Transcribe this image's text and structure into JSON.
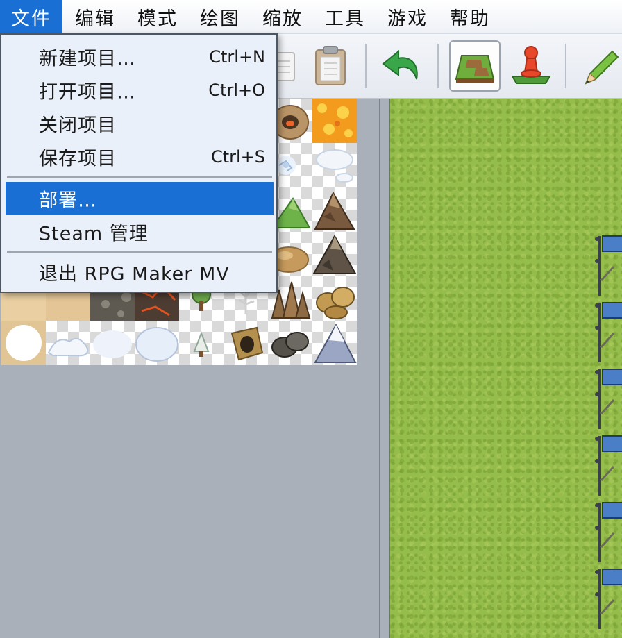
{
  "menubar": {
    "items": [
      "文件",
      "编辑",
      "模式",
      "绘图",
      "缩放",
      "工具",
      "游戏",
      "帮助"
    ],
    "active": "文件"
  },
  "file_menu": {
    "new_project": {
      "label": "新建项目…",
      "shortcut": "Ctrl+N"
    },
    "open_project": {
      "label": "打开项目…",
      "shortcut": "Ctrl+O"
    },
    "close_project": {
      "label": "关闭项目"
    },
    "save_project": {
      "label": "保存项目",
      "shortcut": "Ctrl+S"
    },
    "deploy": {
      "label": "部署…"
    },
    "steam": {
      "label": "Steam 管理"
    },
    "exit": {
      "label": "退出 RPG Maker MV"
    }
  },
  "toolbar": {
    "icons": [
      "copy-icon",
      "paste-icon",
      "undo-icon",
      "map-mode-icon",
      "event-mode-icon",
      "pencil-icon"
    ],
    "pressed": "map-mode-icon"
  },
  "colors": {
    "accent": "#1a6fd4",
    "menu_bg": "#eaf0f9",
    "map_grass": "#95bd4b",
    "panel_bg": "#aab0ba"
  }
}
